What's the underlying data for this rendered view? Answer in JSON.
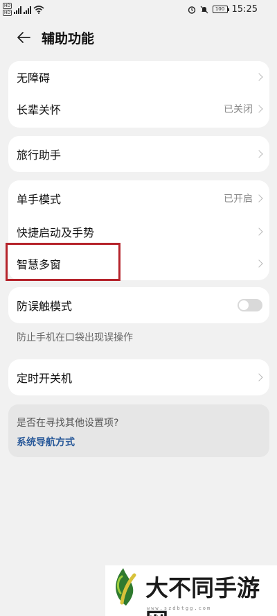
{
  "statusbar": {
    "sim1": "HD",
    "sim2": "HD",
    "battery": "100",
    "time": "15:25"
  },
  "header": {
    "title": "辅助功能"
  },
  "group1": {
    "items": [
      {
        "label": "无障碍",
        "value": ""
      },
      {
        "label": "长辈关怀",
        "value": "已关闭"
      }
    ]
  },
  "group2": {
    "items": [
      {
        "label": "旅行助手",
        "value": ""
      }
    ]
  },
  "group3": {
    "items": [
      {
        "label": "单手模式",
        "value": "已开启"
      },
      {
        "label": "快捷启动及手势",
        "value": ""
      },
      {
        "label": "智慧多窗",
        "value": ""
      }
    ]
  },
  "group4": {
    "label": "防误触模式",
    "toggle_on": false,
    "hint": "防止手机在口袋出现误操作"
  },
  "group5": {
    "label": "定时开关机"
  },
  "search_card": {
    "question": "是否在寻找其他设置项?",
    "link": "系统导航方式"
  },
  "watermark": {
    "text": "大不同手游网",
    "url": "www.szdbtgg.com"
  },
  "colors": {
    "background": "#f1f1f1",
    "card": "#ffffff",
    "highlight": "#b5232b",
    "link": "#2a5a9a"
  }
}
